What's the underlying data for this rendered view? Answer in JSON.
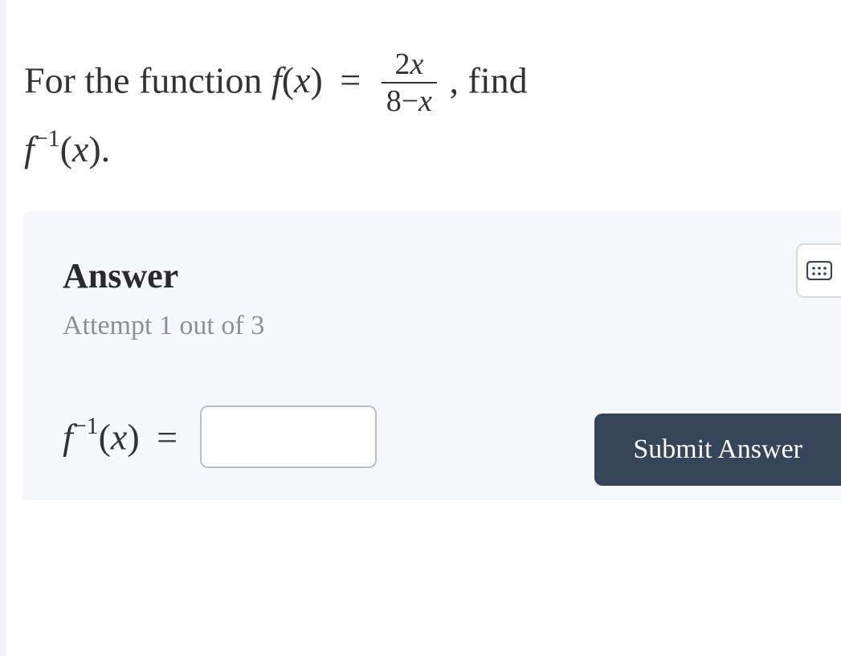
{
  "question": {
    "prefix": "For the function ",
    "func_name": "f",
    "func_arg_open": "(",
    "func_var": "x",
    "func_arg_close": ")",
    "equals": "=",
    "frac_num_coef": "2",
    "frac_num_var": "x",
    "frac_den_left": "8",
    "frac_den_minus": "−",
    "frac_den_var": "x",
    "after_frac": ", find",
    "line2_func": "f",
    "line2_exp_minus": "−",
    "line2_exp_one": "1",
    "line2_arg_open": "(",
    "line2_var": "x",
    "line2_arg_close": ")",
    "line2_period": "."
  },
  "answer": {
    "title": "Answer",
    "attempt": "Attempt 1 out of 3",
    "label_func": "f",
    "label_exp_minus": "−",
    "label_exp_one": "1",
    "label_arg_open": "(",
    "label_var": "x",
    "label_arg_close": ")",
    "label_equals": "=",
    "input_value": "",
    "submit": "Submit Answer"
  },
  "icons": {
    "keypad": "keypad-icon"
  }
}
